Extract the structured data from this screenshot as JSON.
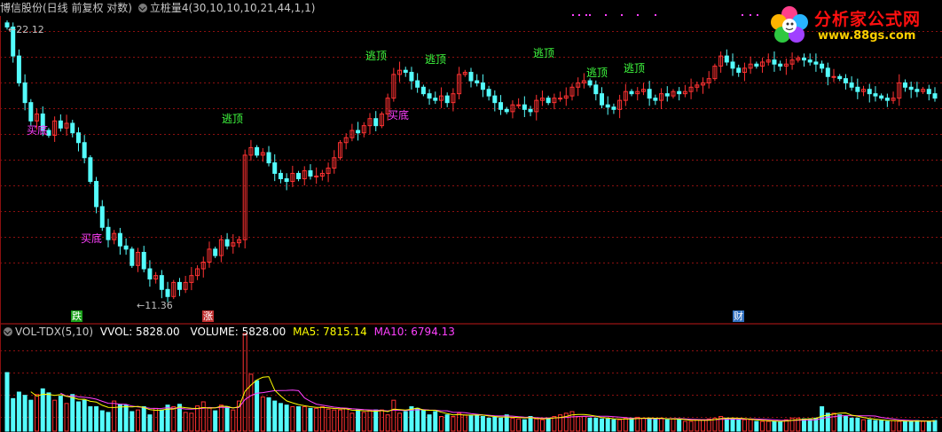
{
  "main_header": {
    "stock": "博信股份(日线 前复权 对数)",
    "indicator": "立桩量4(30,10,10,10,21,44,1,1)"
  },
  "price_labels": {
    "high": "22.12",
    "low": "11.36"
  },
  "signals": [
    {
      "text": "买底",
      "kind": "buy"
    },
    {
      "text": "买底",
      "kind": "buy"
    },
    {
      "text": "逃顶",
      "kind": "sell"
    },
    {
      "text": "逃顶",
      "kind": "sell"
    },
    {
      "text": "买底",
      "kind": "buy"
    },
    {
      "text": "逃顶",
      "kind": "sell"
    },
    {
      "text": "逃顶",
      "kind": "sell"
    },
    {
      "text": "逃顶",
      "kind": "sell"
    },
    {
      "text": "逃顶",
      "kind": "sell"
    }
  ],
  "events": [
    {
      "text": "跌",
      "color": "#1aa01a"
    },
    {
      "text": "涨",
      "color": "#c03030"
    },
    {
      "text": "财",
      "color": "#3070c0"
    }
  ],
  "vol_header": {
    "name": "VOL-TDX(5,10)",
    "vvol": "VVOL: 5828.00",
    "volume": "VOLUME: 5828.00",
    "ma5": "MA5: 7815.14",
    "ma10": "MA10: 6794.13"
  },
  "logo": {
    "title": "分析家公式网",
    "url": "www.88gs.com"
  },
  "colors": {
    "up": "#ff3232",
    "down": "#54fcfc",
    "grid": "#8b1010",
    "buy": "#ff40ff",
    "sell": "#40ff40",
    "ma5": "#ffff00",
    "ma10": "#ff40ff"
  },
  "chart_data": {
    "type": "candlestick",
    "price_range": [
      11.36,
      22.12
    ],
    "close": [
      22.1,
      20.6,
      19.3,
      18.4,
      17.6,
      17.9,
      17.2,
      17.0,
      17.6,
      17.3,
      17.5,
      17.1,
      16.7,
      16.1,
      15.2,
      14.3,
      13.6,
      13.2,
      13.4,
      13.0,
      12.9,
      12.4,
      12.8,
      12.3,
      12.0,
      12.1,
      11.7,
      11.5,
      11.9,
      11.7,
      11.9,
      12.1,
      12.3,
      12.5,
      12.9,
      12.7,
      13.2,
      13.0,
      13.1,
      13.2,
      16.2,
      16.5,
      16.2,
      16.3,
      15.9,
      15.5,
      15.3,
      15.2,
      15.5,
      15.3,
      15.6,
      15.4,
      15.4,
      15.5,
      15.7,
      16.1,
      16.7,
      16.9,
      17.2,
      17.1,
      17.4,
      17.7,
      17.4,
      17.9,
      18.6,
      19.7,
      19.9,
      19.8,
      19.4,
      19.1,
      18.8,
      18.6,
      18.5,
      18.7,
      18.4,
      18.8,
      19.7,
      19.8,
      19.4,
      19.3,
      19.0,
      18.7,
      18.4,
      18.1,
      18.0,
      18.3,
      18.3,
      18.1,
      18.0,
      18.5,
      18.6,
      18.4,
      18.6,
      18.6,
      18.7,
      19.1,
      19.3,
      19.4,
      19.2,
      18.8,
      18.3,
      18.2,
      18.1,
      18.5,
      18.9,
      18.8,
      18.9,
      19.0,
      18.6,
      18.5,
      18.8,
      18.7,
      18.9,
      18.8,
      18.9,
      19.1,
      19.2,
      19.3,
      19.5,
      20.1,
      20.6,
      20.3,
      20.0,
      19.8,
      20.0,
      20.2,
      20.1,
      20.3,
      20.4,
      20.2,
      20.1,
      20.2,
      20.4,
      20.5,
      20.4,
      20.3,
      20.2,
      20.0,
      19.6,
      19.6,
      19.5,
      19.3,
      19.1,
      18.9,
      19.0,
      18.8,
      18.7,
      18.6,
      18.5,
      18.6,
      19.3,
      19.1,
      19.0,
      18.9,
      19.0,
      18.8,
      18.6
    ],
    "volume": [
      72,
      40,
      48,
      44,
      38,
      45,
      52,
      47,
      38,
      43,
      34,
      45,
      36,
      38,
      30,
      30,
      25,
      23,
      37,
      33,
      32,
      24,
      26,
      30,
      20,
      28,
      26,
      32,
      30,
      33,
      23,
      22,
      31,
      36,
      29,
      25,
      32,
      30,
      26,
      37,
      120,
      70,
      62,
      42,
      41,
      37,
      34,
      32,
      30,
      30,
      30,
      28,
      28,
      30,
      27,
      26,
      26,
      28,
      22,
      26,
      23,
      25,
      26,
      26,
      20,
      38,
      22,
      24,
      30,
      28,
      26,
      20,
      24,
      18,
      20,
      18,
      22,
      20,
      19,
      20,
      18,
      16,
      17,
      16,
      20,
      16,
      15,
      14,
      18,
      15,
      14,
      16,
      18,
      20,
      22,
      24,
      18,
      18,
      16,
      16,
      15,
      15,
      14,
      14,
      16,
      16,
      17,
      16,
      15,
      15,
      16,
      14,
      15,
      14,
      12,
      12,
      14,
      14,
      15,
      16,
      18,
      16,
      15,
      14,
      14,
      14,
      12,
      12,
      12,
      12,
      12,
      14,
      16,
      16,
      15,
      15,
      16,
      30,
      22,
      22,
      20,
      18,
      16,
      16,
      14,
      14,
      13,
      13,
      12,
      13,
      12,
      12,
      12,
      13,
      12,
      12,
      13
    ]
  }
}
